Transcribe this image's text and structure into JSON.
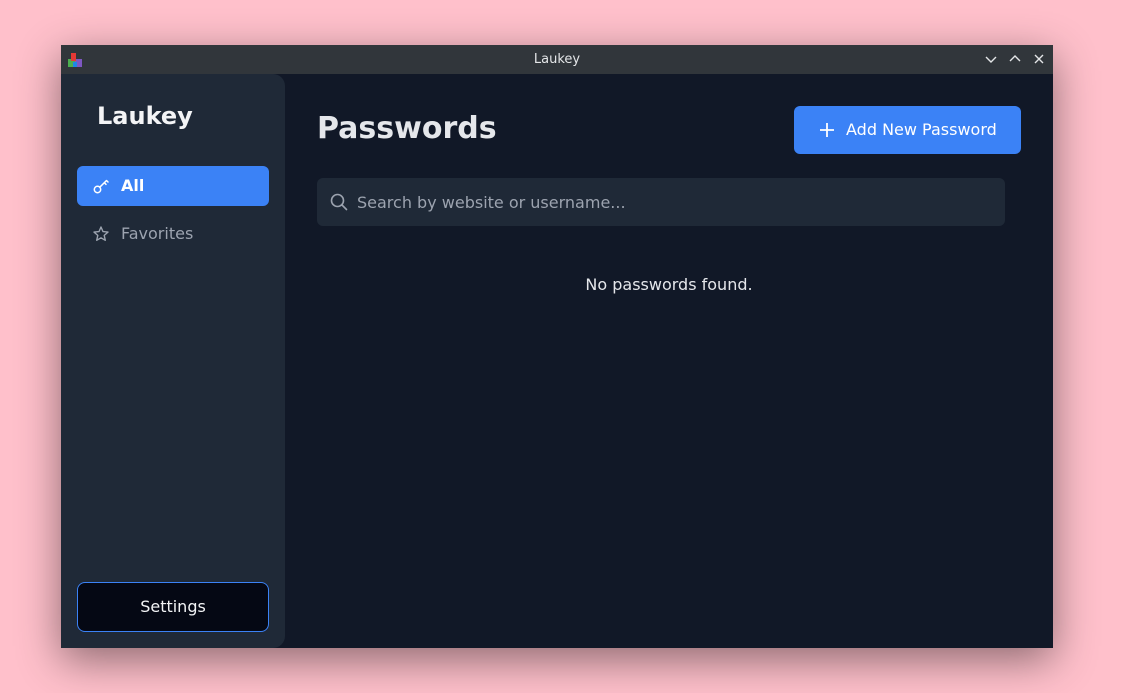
{
  "window": {
    "title": "Laukey"
  },
  "sidebar": {
    "brand": "Laukey",
    "items": [
      {
        "label": "All",
        "icon": "key-icon",
        "active": true
      },
      {
        "label": "Favorites",
        "icon": "star-icon",
        "active": false
      }
    ],
    "settings_label": "Settings"
  },
  "main": {
    "title": "Passwords",
    "add_button_label": "Add New Password",
    "search": {
      "placeholder": "Search by website or username...",
      "value": ""
    },
    "empty_message": "No passwords found."
  },
  "colors": {
    "accent": "#3b82f6",
    "background": "#111827",
    "sidebar": "#1f2937",
    "desktop": "#ffc0cb"
  }
}
